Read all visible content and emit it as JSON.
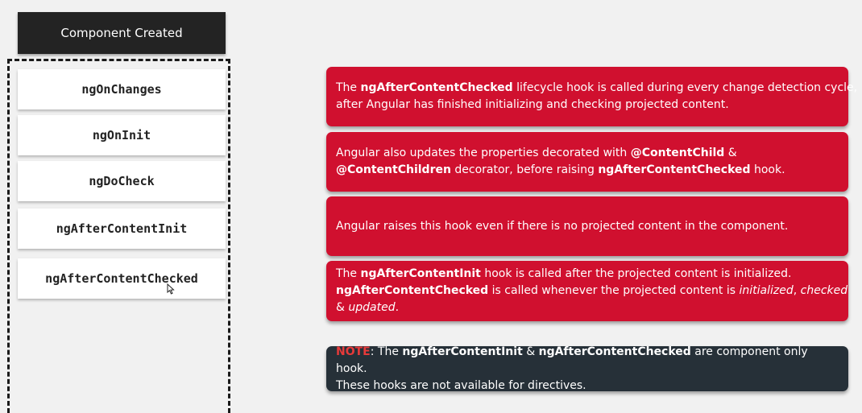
{
  "header": {
    "title": "Component Created"
  },
  "hooks": [
    {
      "label": "ngOnChanges"
    },
    {
      "label": "ngOnInit"
    },
    {
      "label": "ngDoCheck"
    },
    {
      "label": "ngAfterContentInit"
    },
    {
      "label": "ngAfterContentChecked"
    }
  ],
  "cursor": {
    "icon": "mouse-pointer-icon"
  },
  "colors": {
    "info_box": "#d0102f",
    "note_box": "#263038",
    "note_label": "#e83a3a",
    "header_box": "#232323"
  },
  "info": {
    "box1": {
      "p1": "The ",
      "b1": "ngAfterContentChecked",
      "p2": " lifecycle hook is called during every change detection cycle,",
      "p3": "after Angular has finished initializing and checking projected content."
    },
    "box2": {
      "p1": "Angular also updates the properties decorated with ",
      "b1": "@ContentChild",
      "p2": " &",
      "b2": "@ContentChildren",
      "p3": " decorator, before raising ",
      "b3": "ngAfterContentChecked",
      "p4": " hook."
    },
    "box3": {
      "p1": "Angular raises this hook even if there is no projected content in the component."
    },
    "box4": {
      "p1": "The ",
      "b1": "ngAfterContentInit",
      "p2": " hook is called after the projected content is initialized.",
      "b2": "ngAfterContentChecked",
      "p3": " is called whenever the projected content is ",
      "i1": "initialized",
      "p4": ", ",
      "i2": "checked",
      "p5": "& ",
      "i3": "updated",
      "p6": "."
    }
  },
  "note": {
    "label": "NOTE",
    "p1": ": The ",
    "b1": "ngAfterContentInit",
    "p2": " & ",
    "b2": "ngAfterContentChecked",
    "p3": " are component only hook.",
    "p4": "These hooks are not available for directives."
  }
}
